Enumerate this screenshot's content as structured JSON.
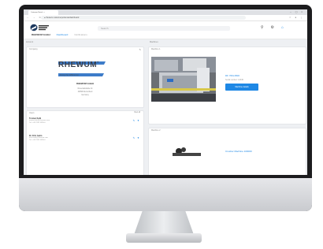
{
  "browser": {
    "tab_title": "Customer Portal  ×  +",
    "window_controls": "– ▢ ×",
    "nav_buttons": "← → C",
    "url": "● rhewum.customerportal.de/dashboard",
    "toolbar_icons": "☆ ● ⋮"
  },
  "header": {
    "search_placeholder": "Search",
    "tabs": [
      {
        "label": "RHEWUM GmbH"
      },
      {
        "label": "Dashboard"
      },
      {
        "label": "Notifications"
      }
    ]
  },
  "sections": {
    "account_label": "Account",
    "machines_label": "Machines"
  },
  "company_card": {
    "title": "Company",
    "logo_text": "RHEWUM",
    "logo_reg": "®",
    "tagline": "Doing the Difference",
    "name": "RHEWUM GmbH",
    "address_lines": [
      "Rosentalstraße 24",
      "42899 Remscheid",
      "Germany"
    ]
  },
  "users_card": {
    "title": "Users",
    "view_all": "View all",
    "users": [
      {
        "name": "Torsten Kahl",
        "email": "torsten.kahl@rhewum.com",
        "phone": "Tel: +49 2191 5995-0"
      },
      {
        "name": "Dr. Fritz Ivelin",
        "email": "fritz.ivelin@rhewum.com",
        "phone": "Tel: +49 2191 5995-0"
      }
    ]
  },
  "machine1": {
    "section_label": "Machine 1",
    "title": "DF 760x1500",
    "subtitle": "Serial number: 12345",
    "button": "Machine details"
  },
  "machine2": {
    "section_label": "Machine 2",
    "title": "Crusher Machine 100000"
  },
  "colors": {
    "accent": "#1e88e5",
    "monitor_bezel": "#1c1c1e",
    "page_bg": "#eef0f3"
  }
}
